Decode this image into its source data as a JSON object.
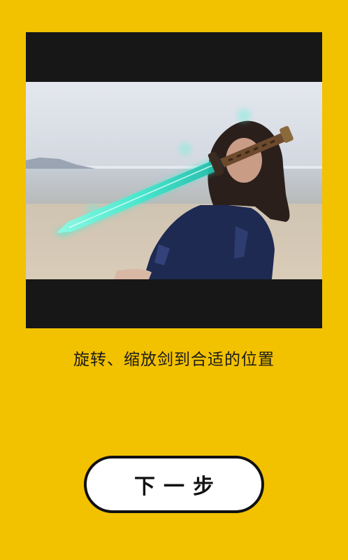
{
  "editor": {
    "instruction": "旋转、缩放剑到合适的位置",
    "image_description_icon": "sword-overlay-photo"
  },
  "actions": {
    "next_label": "下一步"
  },
  "colors": {
    "background": "#F2C100",
    "frame": "#171717",
    "button_fill": "#FFFFFF",
    "button_border": "#111111",
    "sword_glow": "#3FF2D2"
  }
}
